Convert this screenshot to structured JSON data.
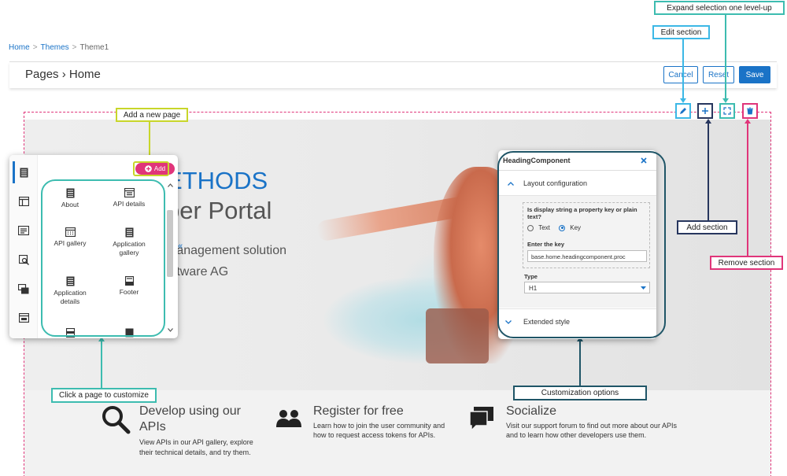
{
  "breadcrumb": {
    "home": "Home",
    "themes": "Themes",
    "current": "Theme1",
    "separator": ">"
  },
  "header": {
    "title": "Pages › Home",
    "cancel": "Cancel",
    "reset": "Reset",
    "save": "Save"
  },
  "hero": {
    "line1": "ETHODS",
    "line2": "per Portal",
    "line3": "management solution",
    "line4": "oftware AG"
  },
  "features": [
    {
      "title_line1": "Develop using our",
      "title_line2": "APIs",
      "desc_line1": "View APIs in our API gallery, explore",
      "desc_line2": "their technical details, and try them.",
      "icon": "search-icon"
    },
    {
      "title_line1": "Register for free",
      "title_line2": "",
      "desc_line1": "Learn how to join the user community and",
      "desc_line2": "how to request access tokens for APIs.",
      "icon": "users-icon"
    },
    {
      "title_line1": "Socialize",
      "title_line2": "",
      "desc_line1": "Visit our support forum to find out more about our APIs",
      "desc_line2": "and to learn how other developers use them.",
      "icon": "chat-icon"
    }
  ],
  "callouts": {
    "expand": "Expand selection one level-up",
    "edit": "Edit section",
    "add_page": "Add a new page",
    "add_section": "Add section",
    "remove_section": "Remove section",
    "click_page": "Click a page to customize",
    "customization": "Customization options"
  },
  "left_panel": {
    "add_label": "Add",
    "pages": [
      {
        "label_line1": "About",
        "label_line2": ""
      },
      {
        "label_line1": "API details",
        "label_line2": ""
      },
      {
        "label_line1": "API gallery",
        "label_line2": ""
      },
      {
        "label_line1": "Application",
        "label_line2": "gallery"
      },
      {
        "label_line1": "Application",
        "label_line2": "details"
      },
      {
        "label_line1": "Footer",
        "label_line2": ""
      }
    ],
    "collapse_glyph": "«"
  },
  "right_panel": {
    "title": "HeadingComponent",
    "layout_section": "Layout configuration",
    "question": "Is display string a property key or plain text?",
    "radio_text": "Text",
    "radio_key": "Key",
    "selected_radio": "Key",
    "key_label": "Enter the key",
    "key_value": "base.home.headingcomponent.proc",
    "type_label": "Type",
    "type_value": "H1",
    "extended_section": "Extended style"
  },
  "colors": {
    "accent_blue": "#1a73c7",
    "pink": "#e0357a",
    "callout_cyan": "#3cb8e6",
    "callout_teal": "#3dbcb0",
    "callout_navy": "#27365e",
    "callout_lime": "#c8d62a",
    "callout_dark_teal": "#1f5567"
  }
}
